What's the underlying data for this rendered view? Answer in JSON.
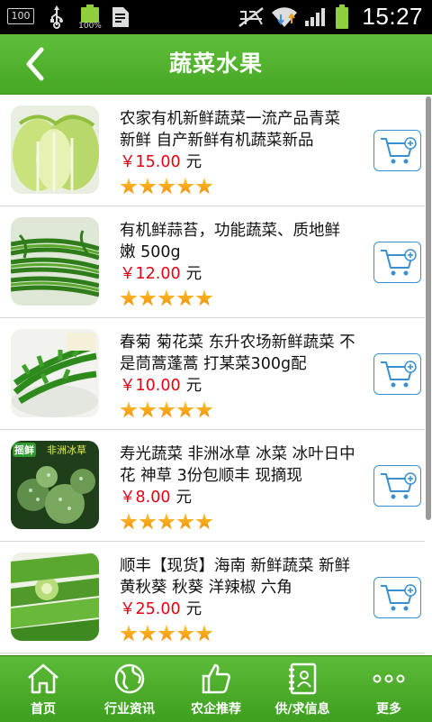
{
  "status_bar": {
    "badge": "100",
    "battery_percent": "100%",
    "time": "15:27",
    "icons": [
      "screen-100-icon",
      "usb-icon",
      "battery-icon",
      "document-icon",
      "no-sim-icon",
      "wifi-icon",
      "signal-icon",
      "battery-icon"
    ]
  },
  "header": {
    "title": "蔬菜水果",
    "back_icon": "chevron-left-icon",
    "color": "#52b22e"
  },
  "products": [
    {
      "title": "农家有机新鲜蔬菜一流产品青菜 新鲜 自产新鲜有机蔬菜新品",
      "price": "￥15.00",
      "unit": "元",
      "rating": 5,
      "image": "napa-cabbage"
    },
    {
      "title": "有机鲜蒜苔，功能蔬菜、质地鲜嫩 500g",
      "price": "￥12.00",
      "unit": "元",
      "rating": 5,
      "image": "garlic-sprouts"
    },
    {
      "title": "春菊 菊花菜 东升农场新鲜蔬菜 不是茼蒿蓬蒿 打某菜300g配",
      "price": "￥10.00",
      "unit": "元",
      "rating": 5,
      "image": "crown-daisy"
    },
    {
      "title": "寿光蔬菜 非洲冰草 冰菜 冰叶日中花 神草 3份包顺丰 现摘现",
      "price": "￥8.00",
      "unit": "元",
      "rating": 5,
      "image": "ice-plant",
      "image_text": "摇鲜 非洲冰草"
    },
    {
      "title": "顺丰【现货】海南 新鲜蔬菜 新鲜黄秋葵 秋葵 洋辣椒 六角",
      "price": "￥25.00",
      "unit": "元",
      "rating": 5,
      "image": "okra"
    }
  ],
  "bottom_nav": [
    {
      "label": "首页",
      "icon": "home-icon"
    },
    {
      "label": "行业资讯",
      "icon": "globe-icon"
    },
    {
      "label": "农企推荐",
      "icon": "thumbs-up-icon"
    },
    {
      "label": "供/求信息",
      "icon": "contacts-icon"
    },
    {
      "label": "更多",
      "icon": "more-dots-icon"
    }
  ],
  "colors": {
    "accent_green": "#52b22e",
    "price_red": "#e60012",
    "cart_blue": "#3a8fd0",
    "star_orange": "#f5a000"
  }
}
